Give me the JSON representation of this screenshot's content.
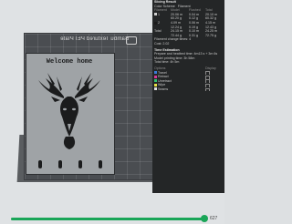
{
  "plate": {
    "label": "Bambu Textured PEI Plate"
  },
  "sign": {
    "title": "Welcome home",
    "hook_count": 4
  },
  "panel": {
    "title": "Slicing Result",
    "scheme_label": "Color Scheme",
    "scheme_value": "Filament",
    "columns": [
      "Filament",
      "Model",
      "Flushed",
      "Total"
    ],
    "rows": [
      {
        "id": "1",
        "color": "#cfcfcf",
        "model": "20.06 m\n60.20 g",
        "flushed": "0.04 m\n0.12 g",
        "total": "20.10 m\n60.32 g"
      },
      {
        "id": "2",
        "color": "#1b1b1b",
        "model": "4.09 m\n12.24 g",
        "flushed": "0.06 m\n0.19 g",
        "total": "4.15 m\n12.43 g"
      },
      {
        "id": "Total",
        "color": "",
        "model": "24.15 m\n72.44 g",
        "flushed": "0.10 m\n0.31 g",
        "total": "24.25 m\n72.75 g"
      }
    ],
    "change_times": "Filament change times: 4",
    "cost": "Cost: 2.02",
    "time_title": "Time Estimation",
    "time_lines": [
      "Prepare and heatbed time: 4m13 s + 3m 6s",
      "Model printing time: 3h 58m",
      "Total time: 4h 5m"
    ],
    "legend_cols": [
      "Options",
      "Display"
    ],
    "legend": [
      {
        "label": "Travel",
        "color": "#3a7bd5"
      },
      {
        "label": "Retract",
        "color": "#d53a9a"
      },
      {
        "label": "Unretract",
        "color": "#2fbf71"
      },
      {
        "label": "Wipe",
        "color": "#e5e044"
      },
      {
        "label": "Seams",
        "color": "#e0e0e0"
      }
    ]
  },
  "slider": {
    "value": "627",
    "fraction": 0.98
  }
}
